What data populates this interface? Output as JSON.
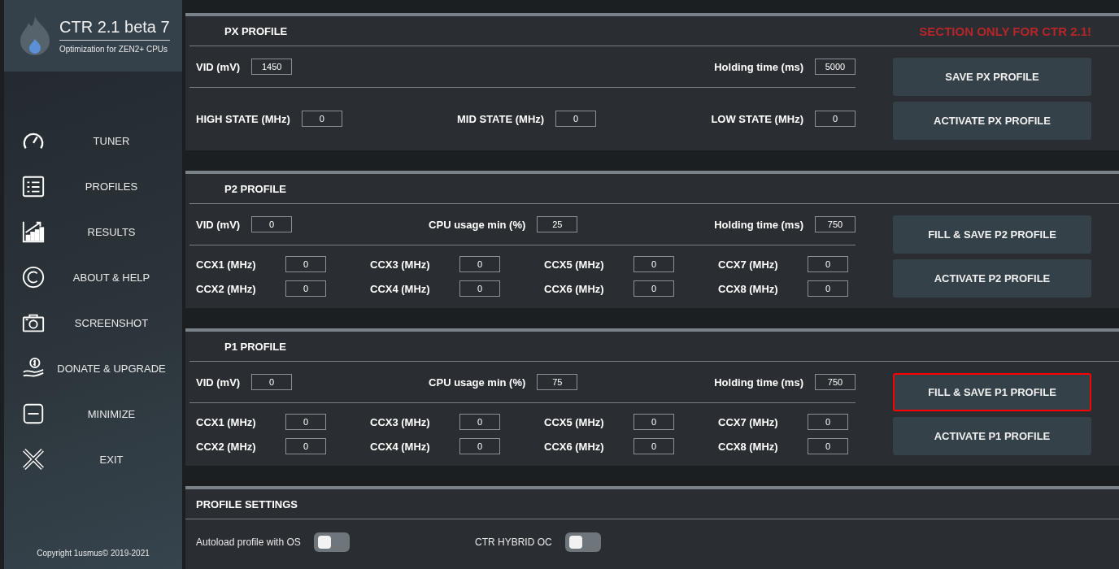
{
  "sidebar": {
    "title": "CTR 2.1 beta 7",
    "subtitle": "Optimization for ZEN2+ CPUs",
    "items": [
      {
        "label": "TUNER",
        "kind": "gauge"
      },
      {
        "label": "PROFILES",
        "kind": "list"
      },
      {
        "label": "RESULTS",
        "kind": "chart"
      },
      {
        "label": "ABOUT & HELP",
        "kind": "copyright"
      },
      {
        "label": "SCREENSHOT",
        "kind": "camera"
      },
      {
        "label": "DONATE & UPGRADE",
        "kind": "donate"
      },
      {
        "label": "MINIMIZE",
        "kind": "minimize"
      },
      {
        "label": "EXIT",
        "kind": "exit"
      }
    ],
    "copyright": "Copyright 1usmus© 2019-2021"
  },
  "panels": [
    {
      "title": "PX PROFILE",
      "notice": "SECTION ONLY FOR CTR 2.1!",
      "top_fields": [
        {
          "label": "VID (mV)",
          "value": "1450"
        },
        {
          "label": "Holding time (ms)",
          "value": "5000"
        }
      ],
      "kind": "states",
      "bottom_fields": [
        {
          "label": "HIGH STATE (MHz)",
          "value": "0"
        },
        {
          "label": "MID STATE (MHz)",
          "value": "0"
        },
        {
          "label": "LOW STATE (MHz)",
          "value": "0"
        }
      ],
      "buttons": [
        {
          "label": "SAVE PX PROFILE",
          "highlighted": false
        },
        {
          "label": "ACTIVATE PX PROFILE",
          "highlighted": false
        }
      ]
    },
    {
      "title": "P2 PROFILE",
      "top_fields": [
        {
          "label": "VID (mV)",
          "value": "0"
        },
        {
          "label": "CPU usage min (%)",
          "value": "25"
        },
        {
          "label": "Holding time (ms)",
          "value": "750"
        }
      ],
      "kind": "cores",
      "bottom_fields": [
        {
          "label": "CCX1 (MHz)",
          "value": "0"
        },
        {
          "label": "CCX2 (MHz)",
          "value": "0"
        },
        {
          "label": "CCX3 (MHz)",
          "value": "0"
        },
        {
          "label": "CCX4 (MHz)",
          "value": "0"
        },
        {
          "label": "CCX5 (MHz)",
          "value": "0"
        },
        {
          "label": "CCX6 (MHz)",
          "value": "0"
        },
        {
          "label": "CCX7 (MHz)",
          "value": "0"
        },
        {
          "label": "CCX8 (MHz)",
          "value": "0"
        }
      ],
      "buttons": [
        {
          "label": "FILL & SAVE P2 PROFILE",
          "highlighted": false
        },
        {
          "label": "ACTIVATE P2 PROFILE",
          "highlighted": false
        }
      ]
    },
    {
      "title": "P1 PROFILE",
      "top_fields": [
        {
          "label": "VID (mV)",
          "value": "0"
        },
        {
          "label": "CPU usage min (%)",
          "value": "75"
        },
        {
          "label": "Holding time (ms)",
          "value": "750"
        }
      ],
      "kind": "cores",
      "bottom_fields": [
        {
          "label": "CCX1 (MHz)",
          "value": "0"
        },
        {
          "label": "CCX2 (MHz)",
          "value": "0"
        },
        {
          "label": "CCX3 (MHz)",
          "value": "0"
        },
        {
          "label": "CCX4 (MHz)",
          "value": "0"
        },
        {
          "label": "CCX5 (MHz)",
          "value": "0"
        },
        {
          "label": "CCX6 (MHz)",
          "value": "0"
        },
        {
          "label": "CCX7 (MHz)",
          "value": "0"
        },
        {
          "label": "CCX8 (MHz)",
          "value": "0"
        }
      ],
      "buttons": [
        {
          "label": "FILL & SAVE P1 PROFILE",
          "highlighted": true
        },
        {
          "label": "ACTIVATE P1 PROFILE",
          "highlighted": false
        }
      ]
    }
  ],
  "settings": {
    "title": "PROFILE SETTINGS",
    "toggles": [
      {
        "label": "Autoload profile with OS",
        "on": false
      },
      {
        "label": "CTR HYBRID OC",
        "on": false
      }
    ]
  }
}
